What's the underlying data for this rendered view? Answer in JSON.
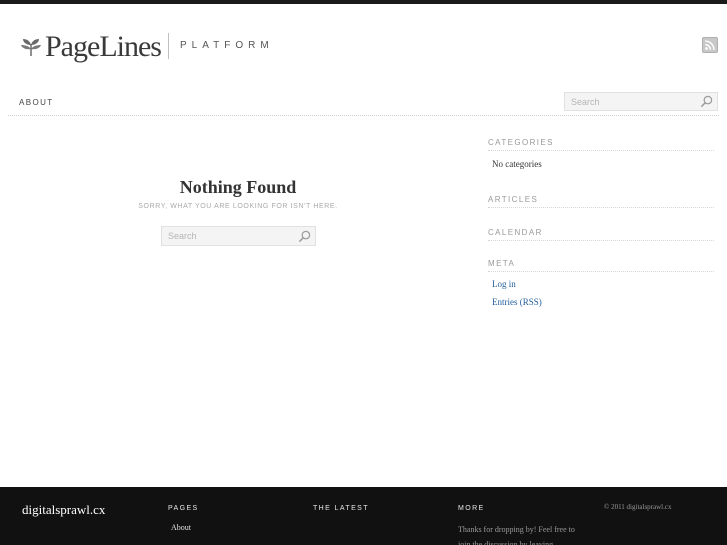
{
  "header": {
    "logo_text": "PageLines",
    "tagline": "PLATFORM"
  },
  "nav": {
    "items": [
      {
        "label": "ABOUT"
      }
    ],
    "search": {
      "placeholder": "Search"
    }
  },
  "main": {
    "title": "Nothing Found",
    "subtitle": "SORRY, WHAT YOU ARE LOOKING FOR ISN'T HERE.",
    "search": {
      "placeholder": "Search"
    }
  },
  "sidebar": {
    "categories": {
      "heading": "CATEGORIES",
      "empty_text": "No categories"
    },
    "articles": {
      "heading": "ARTICLES"
    },
    "calendar": {
      "heading": "CALENDAR"
    },
    "meta": {
      "heading": "META",
      "links": [
        {
          "label": "Log in"
        },
        {
          "label": "Entries (RSS)"
        }
      ]
    }
  },
  "footer": {
    "site_name": "digitalsprawl.cx",
    "pages": {
      "heading": "PAGES",
      "links": [
        {
          "label": "About"
        }
      ]
    },
    "latest": {
      "heading": "THE LATEST"
    },
    "more": {
      "heading": "MORE",
      "text": "Thanks for dropping by! Feel free to join the discussion by leaving"
    },
    "copyright": "© 2011 digitalsprawl.cx"
  },
  "colors": {
    "footer_bg": "#111111",
    "link": "#1f5c9a",
    "top_bar": "#1a1a1a"
  },
  "icons": {
    "logo": "leaf-icon",
    "rss": "rss-icon",
    "search": "search-icon"
  }
}
